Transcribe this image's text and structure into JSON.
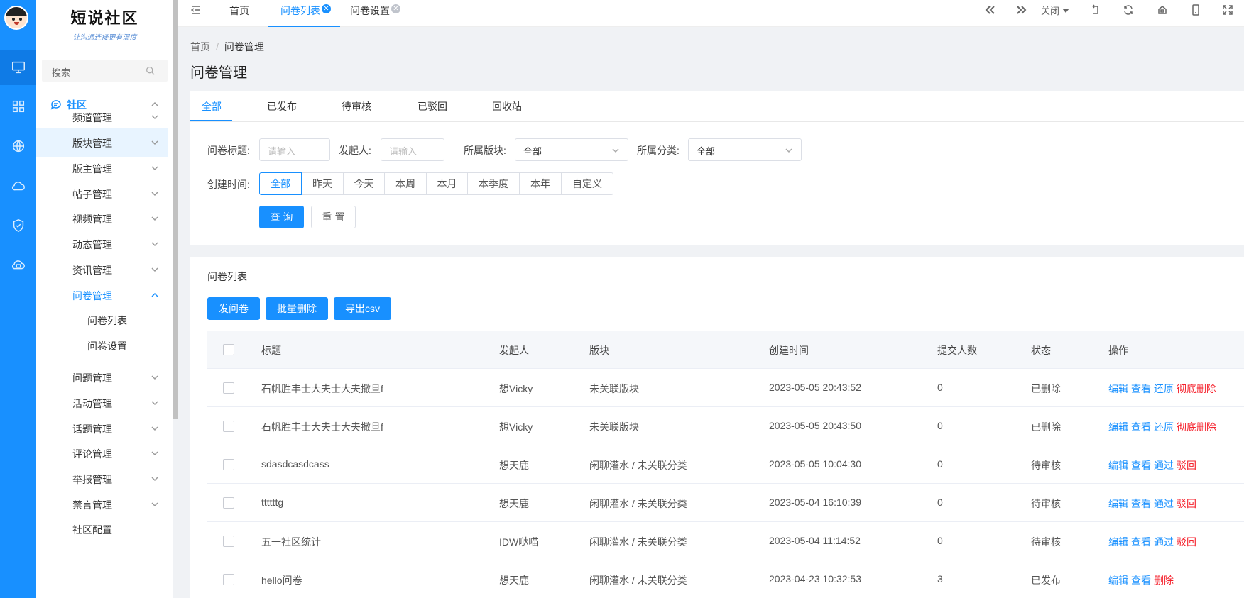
{
  "app": {
    "title": "短说社区",
    "slogan": "让沟通连接更有温度"
  },
  "sidebar": {
    "search_placeholder": "搜索",
    "group_label": "社区",
    "items": [
      {
        "label": "频道管理"
      },
      {
        "label": "版块管理"
      },
      {
        "label": "版主管理"
      },
      {
        "label": "帖子管理"
      },
      {
        "label": "视频管理"
      },
      {
        "label": "动态管理"
      },
      {
        "label": "资讯管理"
      },
      {
        "label": "问卷管理"
      },
      {
        "label": "问卷列表"
      },
      {
        "label": "问卷设置"
      },
      {
        "label": "问题管理"
      },
      {
        "label": "活动管理"
      },
      {
        "label": "话题管理"
      },
      {
        "label": "评论管理"
      },
      {
        "label": "举报管理"
      },
      {
        "label": "禁言管理"
      },
      {
        "label": "社区配置"
      }
    ]
  },
  "tabbar": {
    "tabs": [
      {
        "label": "首页"
      },
      {
        "label": "问卷列表"
      },
      {
        "label": "问卷设置"
      }
    ],
    "close_label": "关闭"
  },
  "breadcrumb": {
    "home": "首页",
    "sep": "/",
    "current": "问卷管理"
  },
  "page_title": "问卷管理",
  "status_tabs": [
    "全部",
    "已发布",
    "待审核",
    "已驳回",
    "回收站"
  ],
  "filters": {
    "title_label": "问卷标题:",
    "title_placeholder": "请输入",
    "creator_label": "发起人:",
    "creator_placeholder": "请输入",
    "board_label": "所属版块:",
    "board_value": "全部",
    "category_label": "所属分类:",
    "category_value": "全部",
    "time_label": "创建时间:",
    "time_options": [
      "全部",
      "昨天",
      "今天",
      "本周",
      "本月",
      "本季度",
      "本年",
      "自定义"
    ],
    "search_button": "查 询",
    "reset_button": "重 置"
  },
  "list": {
    "title": "问卷列表",
    "buttons": [
      "发问卷",
      "批量删除",
      "导出csv"
    ],
    "columns": [
      "标题",
      "发起人",
      "版块",
      "创建时间",
      "提交人数",
      "状态",
      "操作"
    ],
    "rows": [
      {
        "title": "石帆胜丰士大夫士大夫撒旦f",
        "creator": "想Vicky",
        "board": "未关联版块",
        "created": "2023-05-05 20:43:52",
        "count": "0",
        "status": "已删除",
        "ops": [
          {
            "t": "编辑",
            "d": false
          },
          {
            "t": "查看",
            "d": false
          },
          {
            "t": "还原",
            "d": false
          },
          {
            "t": "彻底删除",
            "d": true
          }
        ]
      },
      {
        "title": "石帆胜丰士大夫士大夫撒旦f",
        "creator": "想Vicky",
        "board": "未关联版块",
        "created": "2023-05-05 20:43:50",
        "count": "0",
        "status": "已删除",
        "ops": [
          {
            "t": "编辑",
            "d": false
          },
          {
            "t": "查看",
            "d": false
          },
          {
            "t": "还原",
            "d": false
          },
          {
            "t": "彻底删除",
            "d": true
          }
        ]
      },
      {
        "title": "sdasdcasdcass",
        "creator": "想天鹿",
        "board": "闲聊灌水 / 未关联分类",
        "created": "2023-05-05 10:04:30",
        "count": "0",
        "status": "待审核",
        "ops": [
          {
            "t": "编辑",
            "d": false
          },
          {
            "t": "查看",
            "d": false
          },
          {
            "t": "通过",
            "d": false
          },
          {
            "t": "驳回",
            "d": true
          }
        ]
      },
      {
        "title": "ttttttg",
        "creator": "想天鹿",
        "board": "闲聊灌水 / 未关联分类",
        "created": "2023-05-04 16:10:39",
        "count": "0",
        "status": "待审核",
        "ops": [
          {
            "t": "编辑",
            "d": false
          },
          {
            "t": "查看",
            "d": false
          },
          {
            "t": "通过",
            "d": false
          },
          {
            "t": "驳回",
            "d": true
          }
        ]
      },
      {
        "title": "五一社区统计",
        "creator": "IDW哒喵",
        "board": "闲聊灌水 / 未关联分类",
        "created": "2023-05-04 11:14:52",
        "count": "0",
        "status": "待审核",
        "ops": [
          {
            "t": "编辑",
            "d": false
          },
          {
            "t": "查看",
            "d": false
          },
          {
            "t": "通过",
            "d": false
          },
          {
            "t": "驳回",
            "d": true
          }
        ]
      },
      {
        "title": "hello问卷",
        "creator": "想天鹿",
        "board": "闲聊灌水 / 未关联分类",
        "created": "2023-04-23 10:32:53",
        "count": "3",
        "status": "已发布",
        "ops": [
          {
            "t": "编辑",
            "d": false
          },
          {
            "t": "查看",
            "d": false
          },
          {
            "t": "删除",
            "d": true
          }
        ]
      }
    ]
  },
  "colors": {
    "primary": "#1890ff",
    "danger": "#f5222d",
    "rail": "#1890ff"
  }
}
